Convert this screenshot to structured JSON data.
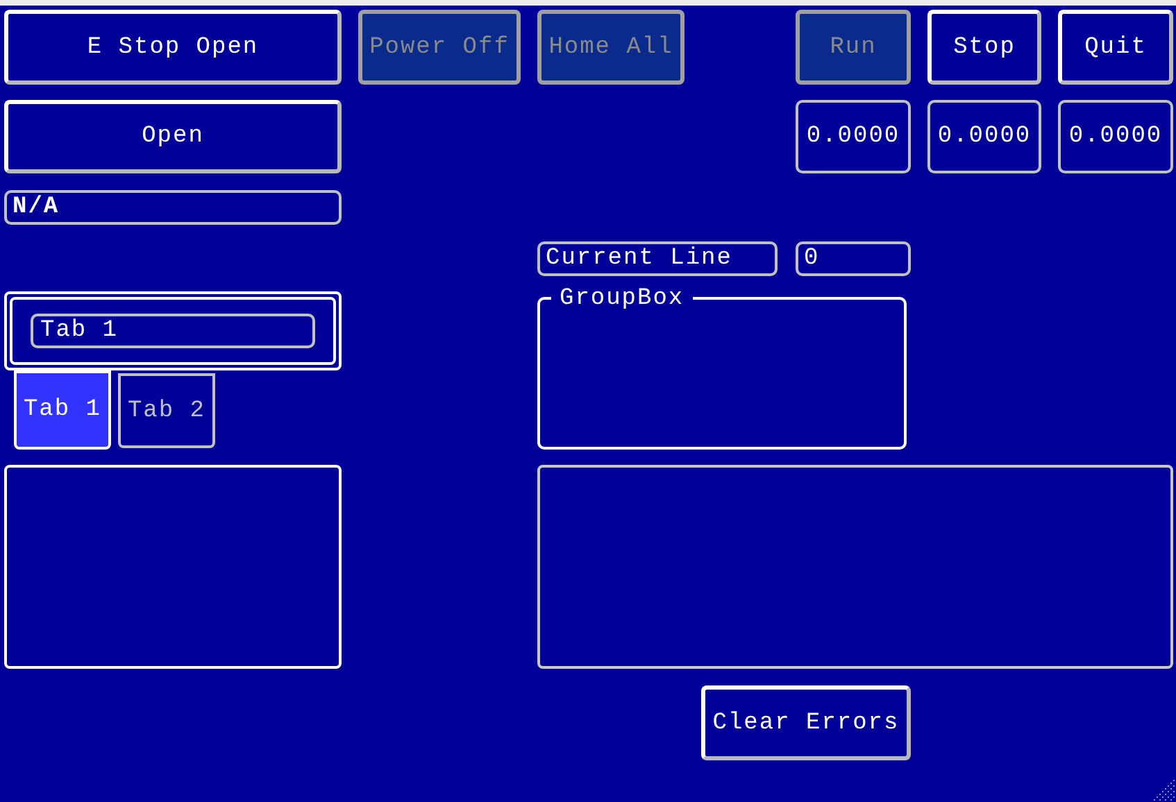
{
  "top_buttons": [
    {
      "label": "E Stop Open",
      "disabled": false
    },
    {
      "label": "Power Off",
      "disabled": true
    },
    {
      "label": "Home All",
      "disabled": true
    },
    {
      "label": "Run",
      "disabled": true
    },
    {
      "label": "Stop",
      "disabled": false
    },
    {
      "label": "Quit",
      "disabled": false
    }
  ],
  "open_button": {
    "label": "Open",
    "disabled": false
  },
  "readouts": [
    "0.0000",
    "0.0000",
    "0.0000"
  ],
  "status_field": {
    "value": "N/A"
  },
  "current_line": {
    "label": "Current Line",
    "value": "0"
  },
  "tab_pane": {
    "field_value": "Tab 1"
  },
  "tabs": [
    {
      "label": "Tab 1",
      "selected": true
    },
    {
      "label": "Tab 2",
      "selected": false
    }
  ],
  "group_box": {
    "title": "GroupBox"
  },
  "clear_errors_button": {
    "label": "Clear Errors",
    "disabled": false
  }
}
